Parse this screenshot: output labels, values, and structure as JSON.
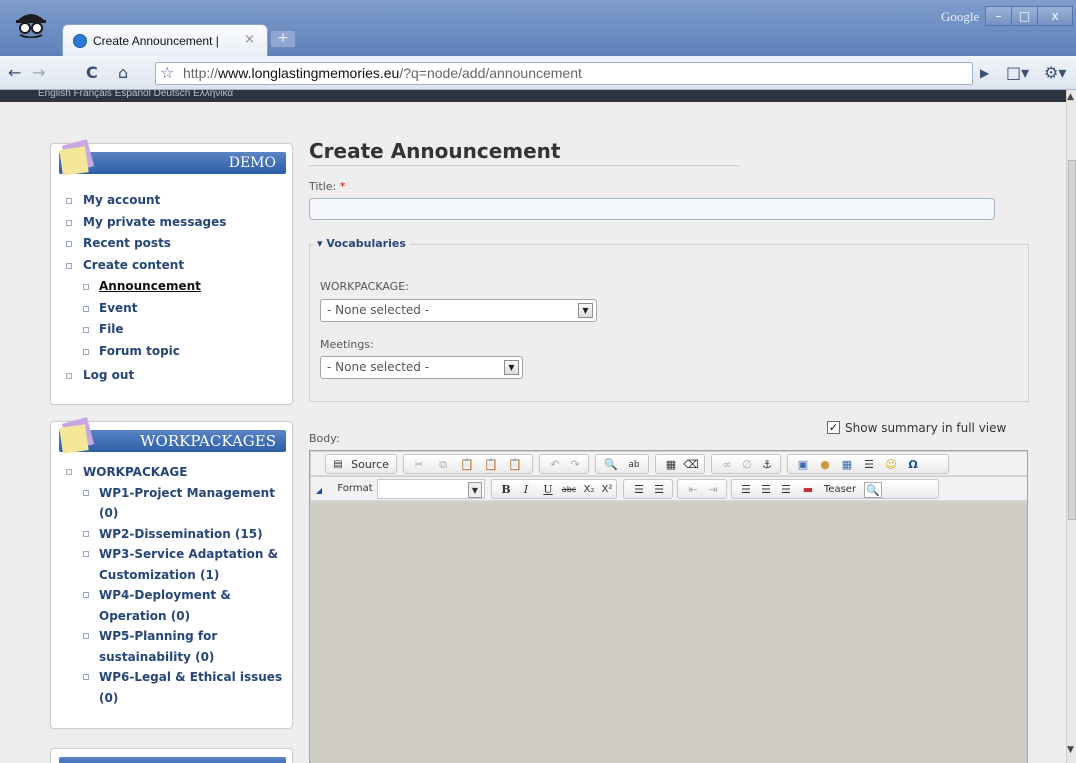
{
  "browser": {
    "tab_title": "Create Announcement |",
    "tab_close": "×",
    "new_tab": "+",
    "profile_label": "Google",
    "win_min": "–",
    "win_max": "□",
    "win_close": "x",
    "url_prefix": "http://",
    "url_domain": "www.longlastingmemories.eu",
    "url_path": "/?q=node/add/announcement"
  },
  "languages": "English   Français   Español   Deutsch   Ελληνικά",
  "sidebar": {
    "demo": {
      "title": "DEMO",
      "items": [
        {
          "label": "My account"
        },
        {
          "label": "My private messages"
        },
        {
          "label": "Recent posts"
        },
        {
          "label": "Create content"
        },
        {
          "label": "Announcement"
        },
        {
          "label": "Event"
        },
        {
          "label": "File"
        },
        {
          "label": "Forum topic"
        },
        {
          "label": "Log out"
        }
      ]
    },
    "workpackages": {
      "title": "WORKPACKAGES",
      "items": [
        {
          "label": "WORKPACKAGE"
        },
        {
          "label": "WP1-Project Management (0)"
        },
        {
          "label": "WP2-Dissemination (15)"
        },
        {
          "label": "WP3-Service Adaptation & Customization (1)"
        },
        {
          "label": "WP4-Deployment & Operation (0)"
        },
        {
          "label": "WP5-Planning for sustainability (0)"
        },
        {
          "label": "WP6-Legal & Ethical issues (0)"
        }
      ]
    }
  },
  "main": {
    "heading": "Create Announcement",
    "title_label": "Title:",
    "required_mark": "*",
    "title_value": "",
    "vocab_legend": "Vocabularies",
    "workpackage_label": "WORKPACKAGE:",
    "workpackage_value": "- None selected -",
    "meetings_label": "Meetings:",
    "meetings_value": "- None selected -",
    "show_summary": "Show summary in full view",
    "show_summary_checked": true,
    "body_label": "Body:"
  },
  "editor": {
    "source_label": "Source",
    "format_label": "Format",
    "teaser_label": "Teaser",
    "bold": "B",
    "italic": "I",
    "underline": "U",
    "strike": "abc",
    "subscript": "X₂",
    "superscript": "X²",
    "omega": "Ω"
  }
}
